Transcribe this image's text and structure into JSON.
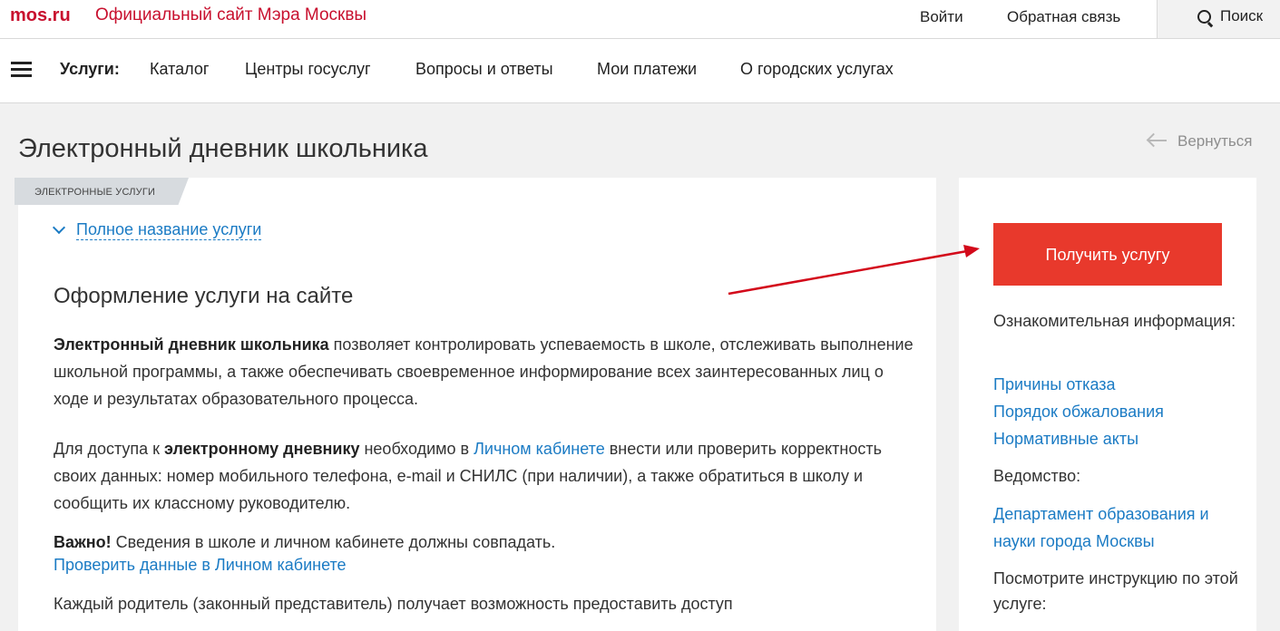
{
  "header": {
    "logo": "mos.ru",
    "site_title": "Официальный сайт Мэра Москвы",
    "login": "Войти",
    "feedback": "Обратная связь",
    "search": "Поиск",
    "search_icon": "search-icon"
  },
  "nav": {
    "menu_icon": "hamburger-icon",
    "label": "Услуги:",
    "items": [
      "Каталог",
      "Центры госуслуг",
      "Вопросы и ответы",
      "Мои платежи",
      "О городских услугах"
    ]
  },
  "page": {
    "title": "Электронный дневник школьника",
    "back": "Вернуться"
  },
  "main": {
    "tag": "ЭЛЕКТРОННЫЕ УСЛУГИ",
    "full_name_link": "Полное название услуги",
    "section_title": "Оформление услуги на сайте",
    "p1_bold": "Электронный дневник школьника",
    "p1_rest": " позволяет контролировать успеваемость в школе, отслеживать выполнение школьной программы, а также обеспечивать своевременное информирование всех заинтересованных лиц о ходе и результатах образовательного процесса.",
    "p2_a": "Для доступа к ",
    "p2_bold": "электронному дневнику",
    "p2_b": " необходимо в ",
    "p2_link": "Личном кабинете",
    "p2_c": " внести или проверить корректность своих данных: номер мобильного телефона, e-mail и СНИЛС (при наличии), а также обратиться в школу и сообщить их классному руководителю.",
    "important_bold": "Важно!",
    "important_rest": " Сведения в школе и личном кабинете должны совпадать.",
    "check_link": "Проверить данные в Личном кабинете",
    "p4": "Каждый родитель (законный представитель) получает возможность предоставить доступ"
  },
  "sidebar": {
    "get_service": "Получить услугу",
    "info_label": "Ознакомительная информация:",
    "links": [
      "Причины отказа",
      "Порядок обжалования",
      "Нормативные акты"
    ],
    "dept_label": "Ведомство:",
    "dept_link": "Департамент образования и науки города Москвы",
    "instruction_label": "Посмотрите инструкцию по этой услуге:"
  },
  "colors": {
    "brand_red": "#c8102e",
    "button_red": "#e8392c",
    "link_blue": "#1b7bc4",
    "annotation_arrow": "#d3091a"
  }
}
